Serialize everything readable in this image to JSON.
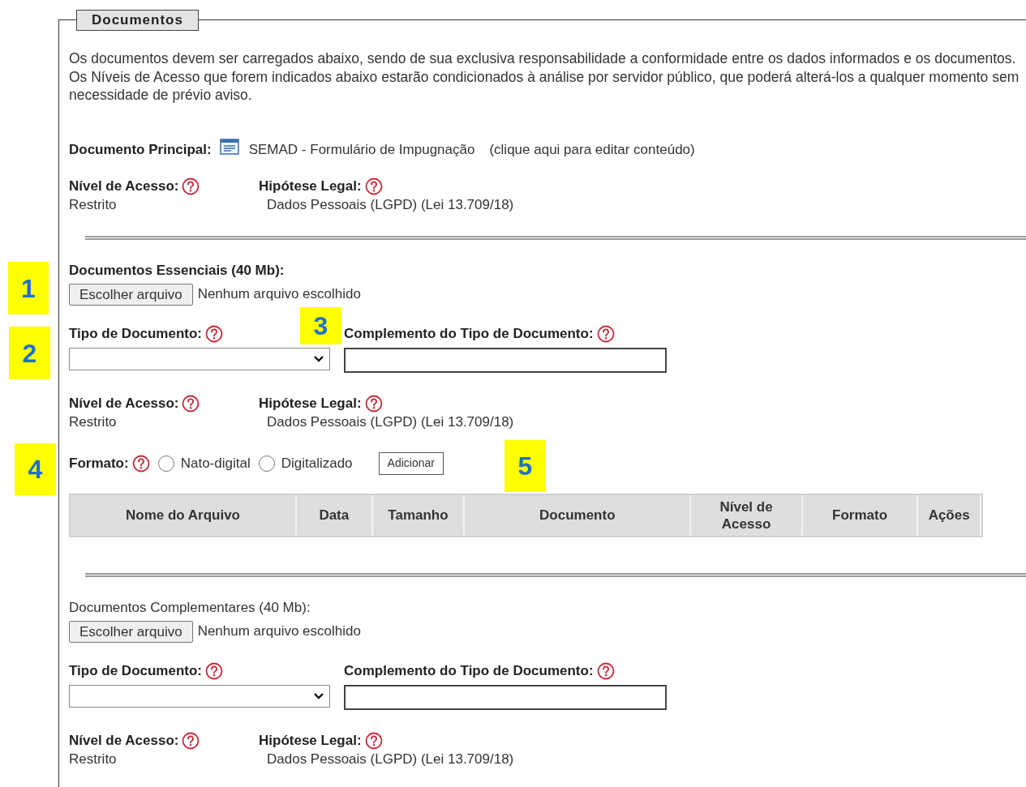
{
  "fieldset": {
    "legend": "Documentos"
  },
  "intro": "Os documentos devem ser carregados abaixo, sendo de sua exclusiva responsabilidade a conformidade entre os dados informados e os documentos. Os Níveis de Acesso que forem indicados abaixo estarão condicionados à análise por servidor público, que poderá alterá-los a qualquer momento sem necessidade de prévio aviso.",
  "main_document": {
    "label": "Documento Principal:",
    "name": "SEMAD - Formulário de Impugnação",
    "edit_hint": "(clique aqui para editar conteúdo)",
    "access": {
      "level_label": "Nível de Acesso:",
      "level_value": "Restrito",
      "legal_label": "Hipótese Legal:",
      "legal_value": "Dados Pessoais (LGPD) (Lei 13.709/18)"
    }
  },
  "sections": [
    {
      "kind": "essential",
      "label": "Documentos Essenciais (40 Mb):",
      "file_button": "Escolher arquivo",
      "file_status": "Nenhum arquivo escolhido",
      "type_label": "Tipo de Documento:",
      "complement_label": "Complemento do Tipo de Documento:",
      "access": {
        "level_label": "Nível de Acesso:",
        "level_value": "Restrito",
        "legal_label": "Hipótese Legal:",
        "legal_value": "Dados Pessoais (LGPD) (Lei 13.709/18)"
      },
      "format": {
        "label": "Formato:",
        "options": [
          {
            "label": "Nato-digital",
            "selected": false
          },
          {
            "label": "Digitalizado",
            "selected": false
          }
        ],
        "add_button": "Adicionar"
      },
      "table": {
        "columns": [
          "Nome do Arquivo",
          "Data",
          "Tamanho",
          "Documento",
          "Nível de Acesso",
          "Formato",
          "Ações"
        ]
      }
    },
    {
      "kind": "complementary",
      "label": "Documentos Complementares (40 Mb):",
      "file_button": "Escolher arquivo",
      "file_status": "Nenhum arquivo escolhido",
      "type_label": "Tipo de Documento:",
      "complement_label": "Complemento do Tipo de Documento:",
      "access": {
        "level_label": "Nível de Acesso:",
        "level_value": "Restrito",
        "legal_label": "Hipótese Legal:",
        "legal_value": "Dados Pessoais (LGPD) (Lei 13.709/18)"
      }
    }
  ],
  "callouts": [
    {
      "label": "1"
    },
    {
      "label": "2"
    },
    {
      "label": "3"
    },
    {
      "label": "4"
    },
    {
      "label": "5"
    }
  ]
}
